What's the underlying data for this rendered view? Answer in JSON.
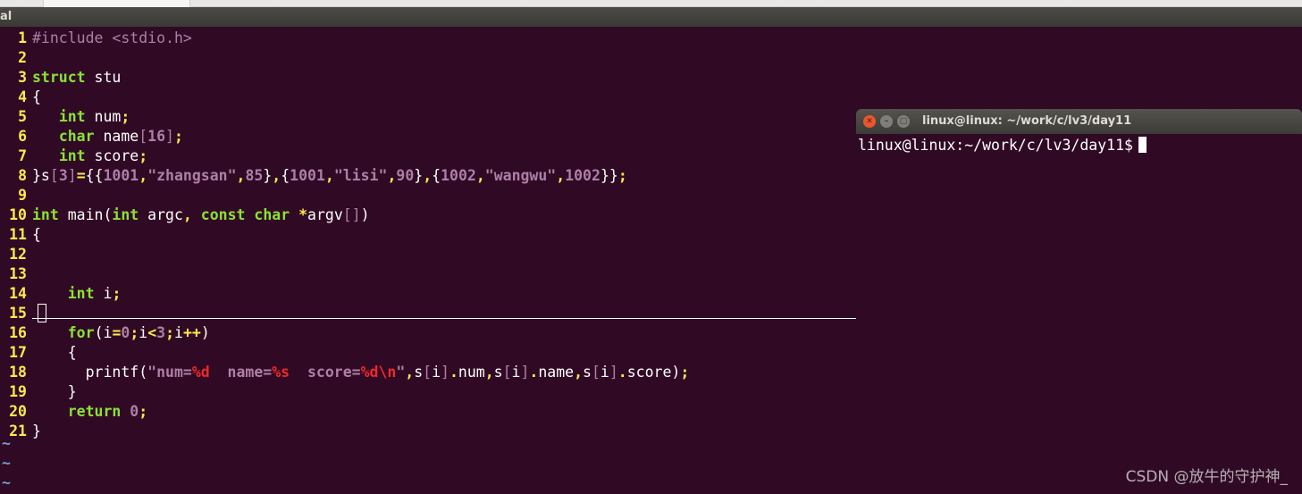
{
  "editor": {
    "title": "al",
    "lines": [
      {
        "n": "1",
        "html": "<span class=\"pp\">#include &lt;stdio.h&gt;</span>"
      },
      {
        "n": "2",
        "html": ""
      },
      {
        "n": "3",
        "html": "<span class=\"kw\">struct</span> stu"
      },
      {
        "n": "4",
        "html": "{"
      },
      {
        "n": "5",
        "html": "   <span class=\"kw\">int</span> num<span class=\"op\">;</span>"
      },
      {
        "n": "6",
        "html": "   <span class=\"kw\">char</span> name<span class=\"br\">[</span><span class=\"nm\">16</span><span class=\"br\">]</span><span class=\"op\">;</span>"
      },
      {
        "n": "7",
        "html": "   <span class=\"kw\">int</span> score<span class=\"op\">;</span>"
      },
      {
        "n": "8",
        "html": "}s<span class=\"br\">[</span><span class=\"nm\">3</span><span class=\"br\">]</span><span class=\"op\">=</span>{{<span class=\"nm\">1001</span><span class=\"op\">,</span><span class=\"st\">\"zhangsan\"</span><span class=\"op\">,</span><span class=\"nm\">85</span>}<span class=\"op\">,</span>{<span class=\"nm\">1001</span><span class=\"op\">,</span><span class=\"st\">\"lisi\"</span><span class=\"op\">,</span><span class=\"nm\">90</span>}<span class=\"op\">,</span>{<span class=\"nm\">1002</span><span class=\"op\">,</span><span class=\"st\">\"wangwu\"</span><span class=\"op\">,</span><span class=\"nm\">1002</span>}}<span class=\"op\">;</span>"
      },
      {
        "n": "9",
        "html": ""
      },
      {
        "n": "10",
        "html": "<span class=\"kw\">int</span> main(<span class=\"kw\">int</span> argc<span class=\"op\">,</span> <span class=\"kw\">const</span> <span class=\"kw\">char</span> <span class=\"op\">*</span>argv<span class=\"br\">[]</span>)"
      },
      {
        "n": "11",
        "html": "{"
      },
      {
        "n": "12",
        "html": ""
      },
      {
        "n": "13",
        "html": ""
      },
      {
        "n": "14",
        "html": "    <span class=\"kw\">int</span> i<span class=\"op\">;</span>"
      },
      {
        "n": "15",
        "html": ""
      },
      {
        "n": "16",
        "html": "    <span class=\"kw\">for</span>(i<span class=\"op\">=</span><span class=\"nm\">0</span><span class=\"op\">;</span>i<span class=\"op\">&lt;</span><span class=\"nm\">3</span><span class=\"op\">;</span>i<span class=\"op\">++</span>)"
      },
      {
        "n": "17",
        "html": "    {"
      },
      {
        "n": "18",
        "html": "      printf(<span class=\"st\">\"num=</span><span class=\"esc\">%d</span><span class=\"st\">  name=</span><span class=\"esc\">%s</span><span class=\"st\">  score=</span><span class=\"esc\">%d\\n</span><span class=\"st\">\"</span><span class=\"op\">,</span>s<span class=\"br\">[</span>i<span class=\"br\">]</span><span class=\"op\">.</span>num<span class=\"op\">,</span>s<span class=\"br\">[</span>i<span class=\"br\">]</span><span class=\"op\">.</span>name<span class=\"op\">,</span>s<span class=\"br\">[</span>i<span class=\"br\">]</span><span class=\"op\">.</span>score)<span class=\"op\">;</span>"
      },
      {
        "n": "19",
        "html": "    }"
      },
      {
        "n": "20",
        "html": "    <span class=\"kw\">return</span> <span class=\"nm\">0</span><span class=\"op\">;</span>"
      },
      {
        "n": "21",
        "html": "}"
      }
    ],
    "tildes": [
      "~",
      "~",
      "~"
    ]
  },
  "terminal": {
    "title": "linux@linux: ~/work/c/lv3/day11",
    "prompt": "linux@linux:~/work/c/lv3/day11$",
    "close_glyph": "✕",
    "min_glyph": "–",
    "max_glyph": "▢"
  },
  "watermark": "CSDN @放牛的守护神_"
}
